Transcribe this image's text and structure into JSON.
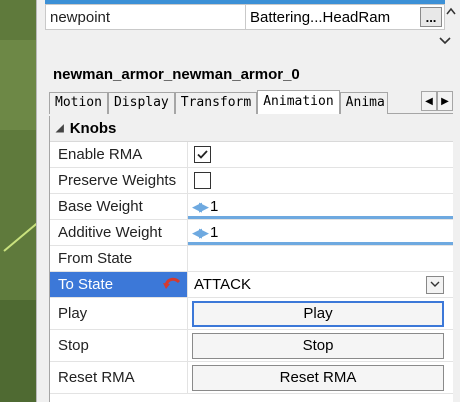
{
  "top_property": {
    "name": "newpoint",
    "value": "Battering...HeadRam",
    "button_label": "..."
  },
  "object_title": "newman_armor_newman_armor_0",
  "tabs": [
    "Motion",
    "Display",
    "Transform",
    "Animation",
    "Anima"
  ],
  "active_tab": "Animation",
  "section": {
    "title": "Knobs"
  },
  "rows": {
    "enable_rma": {
      "label": "Enable RMA",
      "checked": true
    },
    "preserve_weights": {
      "label": "Preserve Weights",
      "checked": false
    },
    "base_weight": {
      "label": "Base Weight",
      "value": "1"
    },
    "additive_weight": {
      "label": "Additive Weight",
      "value": "1"
    },
    "from_state": {
      "label": "From State",
      "value": ""
    },
    "to_state": {
      "label": "To State",
      "value": "ATTACK"
    },
    "play": {
      "label": "Play",
      "button": "Play"
    },
    "stop": {
      "label": "Stop",
      "button": "Stop"
    },
    "reset_rma": {
      "label": "Reset RMA",
      "button": "Reset RMA"
    }
  },
  "colors": {
    "selection": "#3c78d8",
    "slider": "#6ea9e0",
    "revert_icon": "#d43a2f"
  }
}
